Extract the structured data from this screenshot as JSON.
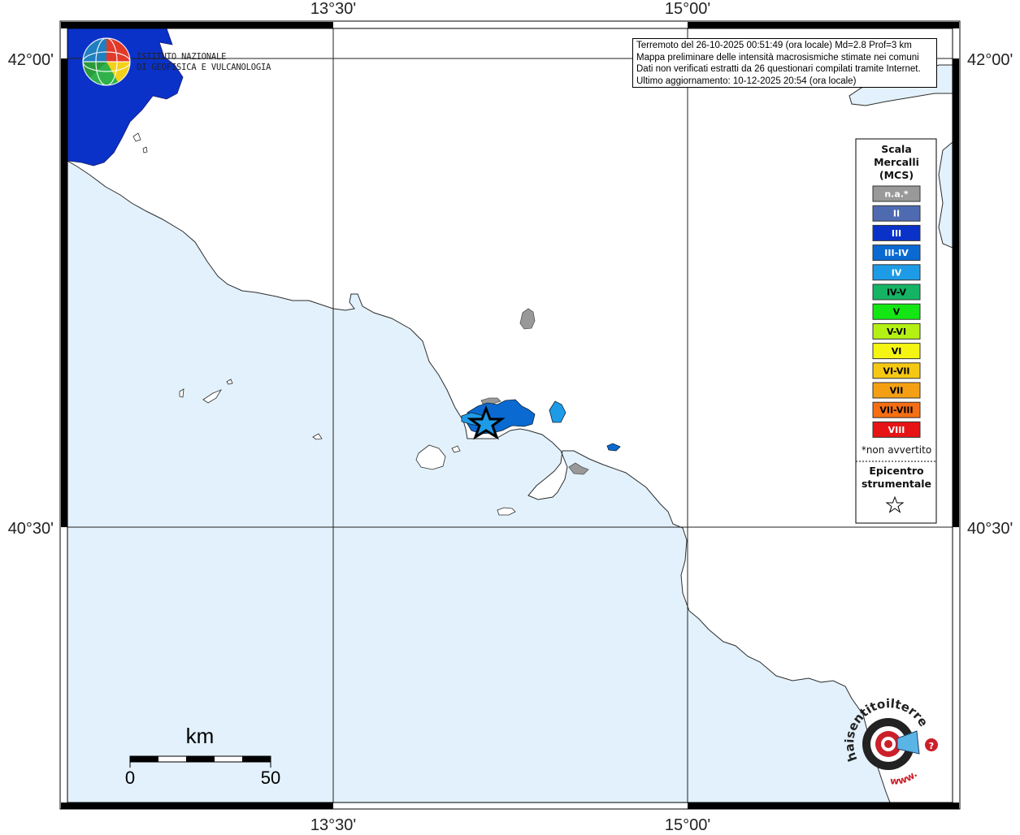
{
  "map": {
    "lon_labels": [
      "13°30'",
      "15°00'"
    ],
    "lat_labels": [
      "42°00'",
      "40°30'"
    ],
    "colors": {
      "sea": "#e2f1fb",
      "land": "#ffffff",
      "coast": "#2d2d2d"
    }
  },
  "header": {
    "info_lines": [
      "Terremoto del 26-10-2025 00:51:49 (ora locale) Md=2.8 Prof=3 km",
      "Mappa preliminare delle intensità macrosismiche stimate nei comuni",
      "Dati non verificati estratti da 26 questionari compilati tramite Internet.",
      "Ultimo aggiornamento: 10-12-2025 20:54 (ora locale)"
    ]
  },
  "logo": {
    "org_line1": "ISTITUTO NAZIONALE",
    "org_line2": "DI GEOFISICA E VULCANOLOGIA"
  },
  "legend": {
    "title_lines": [
      "Scala",
      "Mercalli",
      "(MCS)"
    ],
    "classes": [
      {
        "label": "n.a.*",
        "color": "#999999",
        "text_color": "#ffffff"
      },
      {
        "label": "II",
        "color": "#4e6bb2",
        "text_color": "#ffffff"
      },
      {
        "label": "III",
        "color": "#0a32c8",
        "text_color": "#ffffff"
      },
      {
        "label": "III-IV",
        "color": "#0a6ad2",
        "text_color": "#ffffff"
      },
      {
        "label": "IV",
        "color": "#1e9be6",
        "text_color": "#ffffff"
      },
      {
        "label": "IV-V",
        "color": "#14b464",
        "text_color": "#000000"
      },
      {
        "label": "V",
        "color": "#14e614",
        "text_color": "#000000"
      },
      {
        "label": "V-VI",
        "color": "#b4f014",
        "text_color": "#000000"
      },
      {
        "label": "VI",
        "color": "#f5f514",
        "text_color": "#000000"
      },
      {
        "label": "VI-VII",
        "color": "#f5c814",
        "text_color": "#000000"
      },
      {
        "label": "VII",
        "color": "#f5a014",
        "text_color": "#000000"
      },
      {
        "label": "VII-VIII",
        "color": "#f56e14",
        "text_color": "#000000"
      },
      {
        "label": "VIII",
        "color": "#e61414",
        "text_color": "#ffffff"
      }
    ],
    "note": "*non avvertito",
    "epicenter_lines": [
      "Epicentro",
      "strumentale"
    ]
  },
  "scalebar": {
    "unit": "km",
    "min_label": "0",
    "max_label": "50"
  },
  "footer_logo": {
    "text": "haisentitoilterremoto.it",
    "url_text": "www."
  }
}
